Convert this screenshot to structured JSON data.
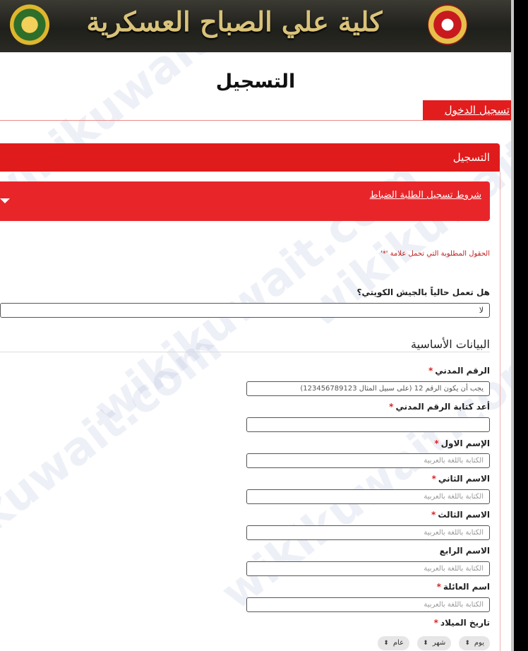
{
  "header": {
    "banner_title": "كلية علي الصباح العسكرية",
    "left_emblem": "college-emblem",
    "right_emblem": "army-emblem"
  },
  "page": {
    "title": "التسجيل",
    "login_tab": "تسجيل الدخول"
  },
  "registration": {
    "panel_title": "التسجيل",
    "terms_link": "شروط تسجيل الطلبة الضباط",
    "required_note": "الحقول المطلوبة التي تحمل علامة '*'",
    "army_question": "هل تعمل حالياً بالجيش الكويتي؟",
    "army_answer": "لا"
  },
  "basic_info": {
    "section_title": "البيانات الأساسية",
    "civil_id_label": "الرقم المدني",
    "civil_id_placeholder": "يجب أن يكون الرقم 12 (على سبيل المثال 123456789123)",
    "civil_id_confirm_label": "أعد كتابة الرقم المدني",
    "first_name_label": "الإسم الاول",
    "second_name_label": "الاسم الثاني",
    "third_name_label": "الاسم الثالث",
    "fourth_name_label": "الاسم الرابع",
    "family_name_label": "اسم العائلة",
    "arabic_placeholder": "الكتابة باللغة بالعربية",
    "dob_label": "تاريخ الميلاد",
    "dob_day": "يوم",
    "dob_month": "شهر",
    "dob_year": "عام",
    "required_star": "*"
  },
  "watermark": "wikikuwait.com",
  "colors": {
    "primary_red": "#e01b1b",
    "banner_gold": "#d9c27a"
  }
}
